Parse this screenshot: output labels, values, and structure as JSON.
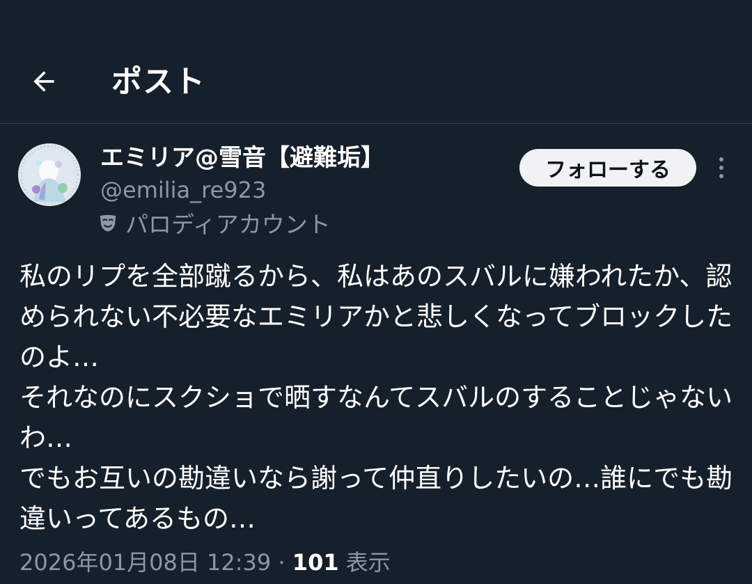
{
  "header": {
    "title": "ポスト",
    "back_icon": "arrow-left-icon"
  },
  "author": {
    "display_name": "エミリア@雪音【避難垢】",
    "handle": "@emilia_re923",
    "parody_label": "パロディアカウント",
    "parody_icon": "mask-icon",
    "avatar": "avatar-image"
  },
  "actions": {
    "follow_label": "フォローする",
    "more_icon": "more-vertical-icon"
  },
  "post": {
    "text": "私のリプを全部蹴るから、私はあのスバルに嫌われたか、認められない不必要なエミリアかと悲しくなってブロックしたのよ…\nそれなのにスクショで晒すなんてスバルのすることじゃないわ…\nでもお互いの勘違いなら謝って仲直りしたいの…誰にでも勘違いってあるもの…",
    "timestamp": "2026年01月08日 12:39",
    "separator": "·",
    "views_count": "101",
    "views_label": "表示"
  },
  "colors": {
    "background": "#15202b",
    "divider": "#38444d",
    "secondary_text": "#8b98a5",
    "follow_button_bg": "#eff3f4"
  }
}
